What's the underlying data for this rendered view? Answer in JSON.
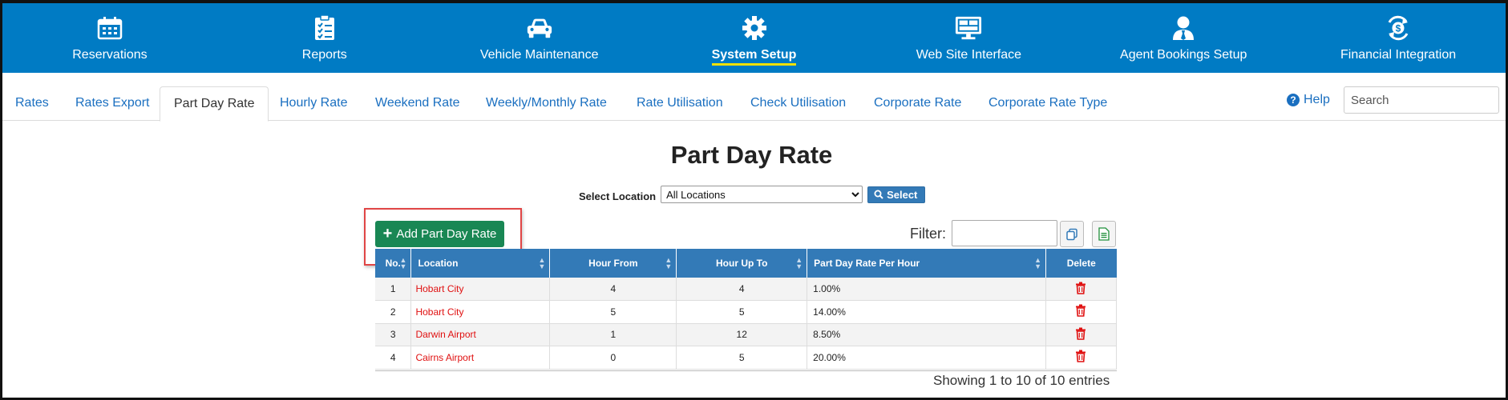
{
  "topnav": [
    {
      "label": "Reservations",
      "icon": "calendar-icon"
    },
    {
      "label": "Reports",
      "icon": "clipboard-icon"
    },
    {
      "label": "Vehicle Maintenance",
      "icon": "car-icon"
    },
    {
      "label": "System Setup",
      "icon": "gear-icon",
      "active": true
    },
    {
      "label": "Web Site Interface",
      "icon": "monitor-icon"
    },
    {
      "label": "Agent Bookings Setup",
      "icon": "agent-icon"
    },
    {
      "label": "Financial Integration",
      "icon": "dollar-sync-icon"
    }
  ],
  "tabs": [
    {
      "label": "Rates"
    },
    {
      "label": "Rates Export"
    },
    {
      "label": "Part Day Rate",
      "active": true
    },
    {
      "label": "Hourly Rate"
    },
    {
      "label": "Weekend Rate"
    },
    {
      "label": "Weekly/Monthly Rate"
    },
    {
      "label": "Rate Utilisation"
    },
    {
      "label": "Check Utilisation"
    },
    {
      "label": "Corporate Rate"
    },
    {
      "label": "Corporate Rate Type"
    }
  ],
  "help_label": "Help",
  "search": {
    "placeholder": "Search",
    "value": ""
  },
  "page_title": "Part Day Rate",
  "location_filter": {
    "label": "Select Location",
    "selected": "All Locations",
    "button_label": "Select"
  },
  "add_button_label": "Add Part Day Rate",
  "filter": {
    "label": "Filter:",
    "value": ""
  },
  "table": {
    "columns": [
      "No.",
      "Location",
      "Hour From",
      "Hour Up To",
      "Part Day Rate Per Hour",
      "Delete"
    ],
    "rows": [
      {
        "no": "1",
        "location": "Hobart City",
        "hour_from": "4",
        "hour_up_to": "4",
        "rate": "1.00%"
      },
      {
        "no": "2",
        "location": "Hobart City",
        "hour_from": "5",
        "hour_up_to": "5",
        "rate": "14.00%"
      },
      {
        "no": "3",
        "location": "Darwin Airport",
        "hour_from": "1",
        "hour_up_to": "12",
        "rate": "8.50%"
      },
      {
        "no": "4",
        "location": "Cairns Airport",
        "hour_from": "0",
        "hour_up_to": "5",
        "rate": "20.00%"
      }
    ]
  },
  "footer_text": "Showing 1 to 10 of 10 entries",
  "colors": {
    "nav_bg": "#007bc4",
    "accent": "#337ab7",
    "add_button": "#198754",
    "highlight": "#e04545",
    "active_underline": "#f3e000",
    "location_text": "#e01010"
  }
}
